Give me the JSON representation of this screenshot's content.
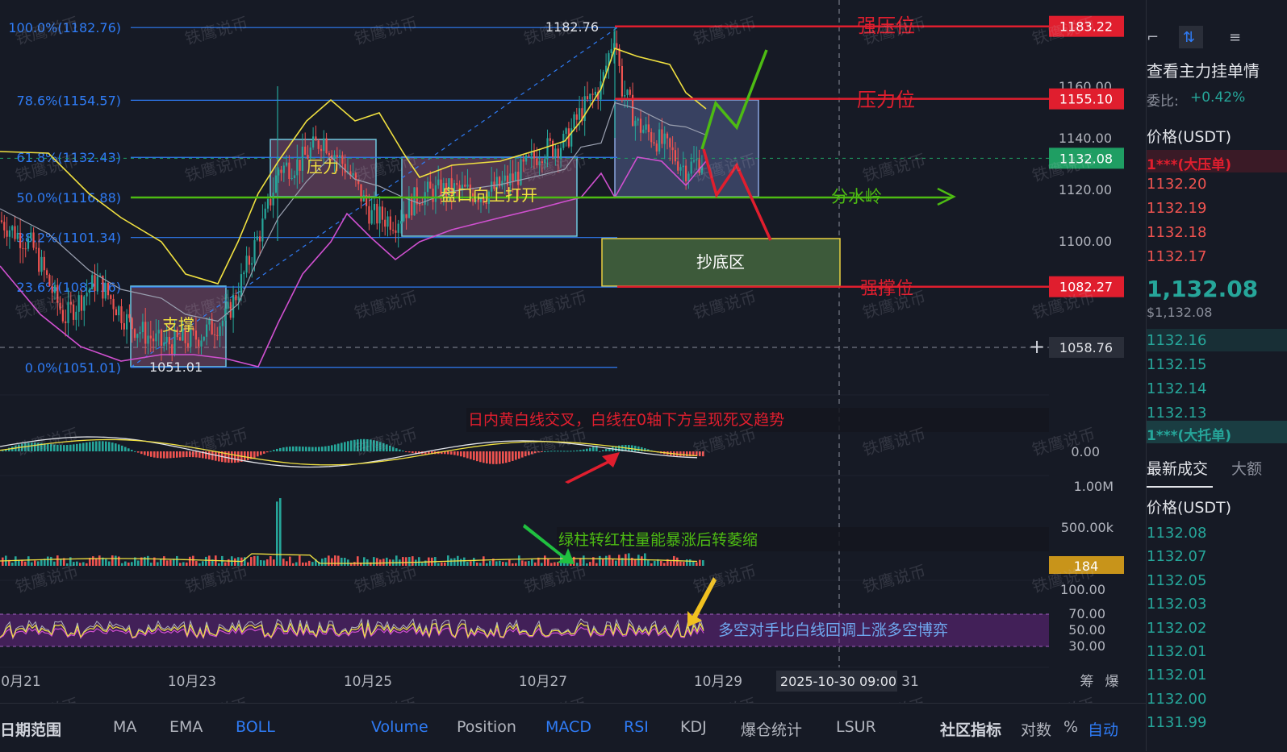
{
  "chart_data": [
    {
      "type": "line",
      "panel": "price",
      "y_axis_ticks": [
        1100,
        1120,
        1140,
        1160
      ],
      "ylim": [
        1040,
        1192
      ],
      "x_axis_ticks": [
        "0月21",
        "10月23",
        "10月25",
        "10月27",
        "10月29",
        "31"
      ],
      "crosshair": {
        "time_label": "2025-10-30 09:00",
        "price_label": "1058.76"
      },
      "fib_levels": [
        {
          "label": "100.0%(1182.76)",
          "value": 1182.76
        },
        {
          "label": "78.6%(1154.57)",
          "value": 1154.57
        },
        {
          "label": "61.8%(1132.43)",
          "value": 1132.43
        },
        {
          "label": "50.0%(1116.88)",
          "value": 1116.88
        },
        {
          "label": "38.2%(1101.34)",
          "value": 1101.34
        },
        {
          "label": "23.6%(1082.16)",
          "value": 1082.16
        },
        {
          "label": "0.0%(1051.01)",
          "value": 1051.01
        }
      ],
      "high_marker": "1182.76",
      "low_marker": "1051.01",
      "price_tags": [
        {
          "label": "1183.22",
          "value": 1183.22,
          "color": "#e01e2e"
        },
        {
          "label": "1155.10",
          "value": 1155.1,
          "color": "#e01e2e"
        },
        {
          "label": "1132.08",
          "value": 1132.08,
          "color": "#1f9e63"
        },
        {
          "label": "1082.27",
          "value": 1082.27,
          "color": "#e01e2e"
        }
      ],
      "annotations": {
        "strong_resistance": "强压位",
        "resistance": "压力位",
        "watershed": "分水岭",
        "bottom_zone": "抄底区",
        "strong_support": "强撑位",
        "box_resistance": "压力",
        "box_breakout": "盘口向上打开",
        "box_support": "支撑"
      },
      "close_series_x": [
        "0月21",
        "10月23",
        "10月25",
        "10月27",
        "10月29"
      ],
      "close_series": [
        1105,
        1062,
        1122,
        1150,
        1132
      ]
    },
    {
      "type": "bar",
      "panel": "macd",
      "y_axis_ticks": [
        "0.00"
      ],
      "annotation": "日内黄白线交叉，白线在0轴下方呈现死叉趋势"
    },
    {
      "type": "bar",
      "panel": "volume",
      "y_axis_ticks": [
        "1.00M",
        "500.00k"
      ],
      "current_label": "184",
      "annotation": "绿柱转红柱量能暴涨后转萎缩"
    },
    {
      "type": "line",
      "panel": "rsi",
      "y_axis_ticks": [
        "100.00",
        "70.00",
        "50.00",
        "30.00"
      ],
      "annotation": "多空对手比白线回调上涨多空博弈"
    }
  ],
  "watermark": "铁鹰说币",
  "right_axis_icons": [
    "筹",
    "爆"
  ],
  "toolbar": {
    "date_range": "日期范围",
    "items": [
      "MA",
      "EMA",
      "BOLL",
      "Volume",
      "Position",
      "MACD",
      "RSI",
      "KDJ",
      "爆仓统计",
      "LSUR",
      "社区指标",
      "对数",
      "%",
      "自动"
    ]
  },
  "orderbook": {
    "title": "查看主力挂单情",
    "ratio_label": "委比:",
    "ratio_value": "+0.42%",
    "price_header": "价格(USDT)",
    "ask_big": "1***(大压单)",
    "asks": [
      "1132.20",
      "1132.19",
      "1132.18",
      "1132.17"
    ],
    "last_price": "1,132.08",
    "last_usd": "$1,132.08",
    "bids": [
      "1132.16",
      "1132.15",
      "1132.14",
      "1132.13"
    ],
    "bid_big": "1***(大托单)",
    "trades_tab": "最新成交",
    "trades_tab2": "大额",
    "trades_header": "价格(USDT)",
    "trades": [
      "1132.08",
      "1132.07",
      "1132.05",
      "1132.03",
      "1132.02",
      "1132.01",
      "1132.01",
      "1132.00",
      "1131.99"
    ]
  },
  "colors": {
    "background": "#161a25",
    "fib": "#2f7cf6",
    "up": "#26a69a",
    "down": "#ef5350",
    "red_line": "#e01e2e",
    "green_line": "#4dbb13",
    "yellow": "#f0e040",
    "magenta": "#d050d0"
  }
}
